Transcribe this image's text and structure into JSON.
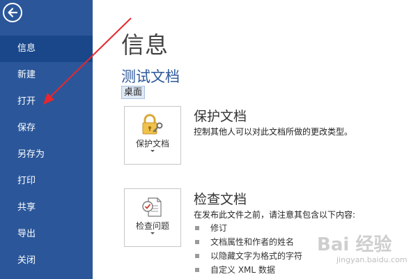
{
  "sidebar": {
    "items": [
      {
        "label": "信息",
        "active": true
      },
      {
        "label": "新建"
      },
      {
        "label": "打开"
      },
      {
        "label": "保存"
      },
      {
        "label": "另存为"
      },
      {
        "label": "打印"
      },
      {
        "label": "共享"
      },
      {
        "label": "导出"
      },
      {
        "label": "关闭"
      }
    ]
  },
  "main": {
    "title": "信息",
    "document_name": "测试文档",
    "location": "桌面",
    "protect": {
      "button_label": "保护文档",
      "title": "保护文档",
      "description": "控制其他人可以对此文档所做的更改类型。"
    },
    "inspect": {
      "button_label": "检查问题",
      "title": "检查文档",
      "description": "在发布此文件之前，请注意其包含以下内容:",
      "items": [
        "修订",
        "文档属性和作者的姓名",
        "以隐藏文字为格式的字符",
        "自定义 XML 数据"
      ]
    }
  },
  "watermark": {
    "text": "Bai 经验",
    "url": "jingyan.baidu.com"
  },
  "colors": {
    "sidebar": "#2b579a",
    "sidebar_active": "#19478a",
    "accent": "#2b579a",
    "annotation_arrow": "#e8262d"
  }
}
